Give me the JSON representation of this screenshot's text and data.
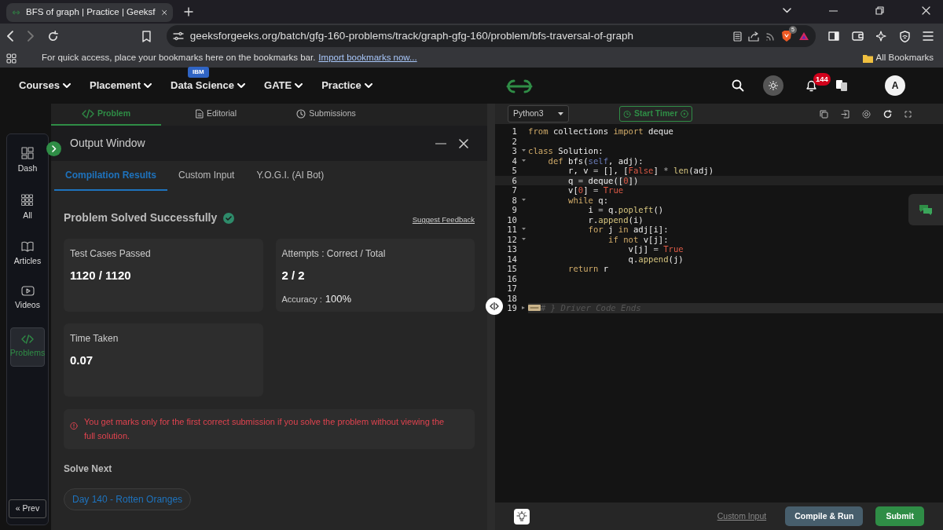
{
  "browser": {
    "tab": {
      "title": "BFS of graph | Practice | Geeksf",
      "selected": true
    },
    "url": "geeksforgeeks.org/batch/gfg-160-problems/track/graph-gfg-160/problem/bfs-traversal-of-graph",
    "shield_count": "5",
    "bookmarks_hint": "For quick access, place your bookmarks here on the bookmarks bar.",
    "bookmarks_link": "Import bookmarks now...",
    "all_bookmarks": "All Bookmarks"
  },
  "site_nav": {
    "menus": [
      {
        "label": "Courses"
      },
      {
        "label": "Placement"
      },
      {
        "label": "Data Science",
        "badge": "IBM"
      },
      {
        "label": "GATE"
      },
      {
        "label": "Practice"
      }
    ],
    "notification_count": "144",
    "avatar": "A"
  },
  "sidebar": {
    "items": [
      {
        "label": "Dash",
        "selected": false
      },
      {
        "label": "All",
        "selected": false
      },
      {
        "label": "Articles",
        "selected": false
      },
      {
        "label": "Videos",
        "selected": false
      },
      {
        "label": "Problems",
        "selected": true
      }
    ],
    "prev_button": "« Prev"
  },
  "problem_tabs": [
    {
      "label": "Problem",
      "selected": true
    },
    {
      "label": "Editorial",
      "selected": false
    },
    {
      "label": "Submissions",
      "selected": false
    }
  ],
  "output_window": {
    "title": "Output Window",
    "tabs": [
      {
        "label": "Compilation Results",
        "selected": true
      },
      {
        "label": "Custom Input",
        "selected": false
      },
      {
        "label": "Y.O.G.I. (AI Bot)",
        "selected": false
      }
    ],
    "status": "Problem Solved Successfully",
    "feedback_link": "Suggest Feedback",
    "stats": [
      {
        "label": "Test Cases Passed",
        "value": "1120 / 1120"
      },
      {
        "label": "Attempts : Correct / Total",
        "value": "2 / 2",
        "note_label": "Accuracy :",
        "note_value": "100%"
      },
      {
        "label": "Time Taken",
        "value": "0.07"
      }
    ],
    "notice": "You get marks only for the first correct submission if you solve the problem without viewing the full solution.",
    "solve_next": {
      "heading": "Solve Next",
      "items": [
        "Day 140 - Rotten Oranges"
      ]
    }
  },
  "editor": {
    "language": "Python3",
    "timer_button": "Start Timer",
    "lines": [
      {
        "number": "1",
        "foldable": false,
        "folded": false,
        "current": false,
        "tokens": [
          {
            "text": "from",
            "kind": "kw"
          },
          {
            "text": " collections ",
            "kind": "name"
          },
          {
            "text": "import",
            "kind": "kw"
          },
          {
            "text": " deque",
            "kind": "name"
          }
        ]
      },
      {
        "number": "2",
        "foldable": false,
        "folded": false,
        "current": false
      },
      {
        "number": "3",
        "foldable": true,
        "folded": false,
        "current": false,
        "tokens": [
          {
            "text": "class",
            "kind": "kw"
          },
          {
            "text": " Solution:",
            "kind": "name"
          }
        ]
      },
      {
        "number": "4",
        "foldable": true,
        "folded": false,
        "current": false,
        "tokens": [
          {
            "text": "    def",
            "kind": "kw"
          },
          {
            "text": " bfs(",
            "kind": "name"
          },
          {
            "text": "self",
            "kind": "self"
          },
          {
            "text": ", adj):",
            "kind": "name"
          }
        ]
      },
      {
        "number": "5",
        "foldable": false,
        "folded": false,
        "current": false,
        "tokens": [
          {
            "text": "        r, v ",
            "kind": "name"
          },
          {
            "text": "=",
            "kind": "op"
          },
          {
            "text": " [], [",
            "kind": "name"
          },
          {
            "text": "False",
            "kind": "const"
          },
          {
            "text": "] ",
            "kind": "name"
          },
          {
            "text": "*",
            "kind": "op"
          },
          {
            "text": " len",
            "kind": "fn"
          },
          {
            "text": "(adj)",
            "kind": "name"
          }
        ]
      },
      {
        "number": "6",
        "foldable": false,
        "folded": false,
        "current": true,
        "tokens": [
          {
            "text": "        q ",
            "kind": "name"
          },
          {
            "text": "=",
            "kind": "op"
          },
          {
            "text": " deque([",
            "kind": "name"
          },
          {
            "text": "0",
            "kind": "const"
          },
          {
            "text": "])",
            "kind": "name"
          }
        ]
      },
      {
        "number": "7",
        "foldable": false,
        "folded": false,
        "current": false,
        "tokens": [
          {
            "text": "        v[",
            "kind": "name"
          },
          {
            "text": "0",
            "kind": "const"
          },
          {
            "text": "] ",
            "kind": "name"
          },
          {
            "text": "=",
            "kind": "op"
          },
          {
            "text": " True",
            "kind": "const"
          }
        ]
      },
      {
        "number": "8",
        "foldable": true,
        "folded": false,
        "current": false,
        "tokens": [
          {
            "text": "        while",
            "kind": "kw"
          },
          {
            "text": " q:",
            "kind": "name"
          }
        ]
      },
      {
        "number": "9",
        "foldable": false,
        "folded": false,
        "current": false,
        "tokens": [
          {
            "text": "            i ",
            "kind": "name"
          },
          {
            "text": "=",
            "kind": "op"
          },
          {
            "text": " q.",
            "kind": "name"
          },
          {
            "text": "popleft",
            "kind": "fn"
          },
          {
            "text": "()",
            "kind": "name"
          }
        ]
      },
      {
        "number": "10",
        "foldable": false,
        "folded": false,
        "current": false,
        "tokens": [
          {
            "text": "            r.",
            "kind": "name"
          },
          {
            "text": "append",
            "kind": "fn"
          },
          {
            "text": "(i)",
            "kind": "name"
          }
        ]
      },
      {
        "number": "11",
        "foldable": true,
        "folded": false,
        "current": false,
        "tokens": [
          {
            "text": "            for",
            "kind": "kw"
          },
          {
            "text": " j ",
            "kind": "name"
          },
          {
            "text": "in",
            "kind": "kw"
          },
          {
            "text": " adj[i]:",
            "kind": "name"
          }
        ]
      },
      {
        "number": "12",
        "foldable": true,
        "folded": false,
        "current": false,
        "tokens": [
          {
            "text": "                if",
            "kind": "kw"
          },
          {
            "text": " not",
            "kind": "kw"
          },
          {
            "text": " v[j]:",
            "kind": "name"
          }
        ]
      },
      {
        "number": "13",
        "foldable": false,
        "folded": false,
        "current": false,
        "tokens": [
          {
            "text": "                    v[j] ",
            "kind": "name"
          },
          {
            "text": "=",
            "kind": "op"
          },
          {
            "text": " True",
            "kind": "const"
          }
        ]
      },
      {
        "number": "14",
        "foldable": false,
        "folded": false,
        "current": false,
        "tokens": [
          {
            "text": "                    q.",
            "kind": "name"
          },
          {
            "text": "append",
            "kind": "fn"
          },
          {
            "text": "(j)",
            "kind": "name"
          }
        ]
      },
      {
        "number": "15",
        "foldable": false,
        "folded": false,
        "current": false,
        "tokens": [
          {
            "text": "        return",
            "kind": "kw"
          },
          {
            "text": " r",
            "kind": "name"
          }
        ]
      },
      {
        "number": "16",
        "foldable": false,
        "folded": false,
        "current": false
      },
      {
        "number": "17",
        "foldable": false,
        "folded": false,
        "current": false
      },
      {
        "number": "18",
        "foldable": false,
        "folded": false,
        "current": false
      },
      {
        "number": "19",
        "foldable": true,
        "folded": true,
        "current": false,
        "tokens": [
          {
            "text": "# } Driver Code Ends",
            "kind": "cmt"
          }
        ]
      }
    ],
    "custom_input_link": "Custom Input",
    "compile_button": "Compile & Run",
    "submit_button": "Submit"
  }
}
